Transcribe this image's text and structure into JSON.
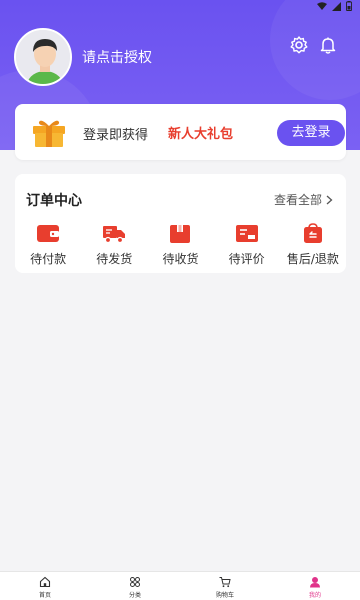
{
  "header": {
    "auth_prompt": "请点击授权"
  },
  "promo": {
    "text": "登录即获得",
    "highlight": "新人大礼包",
    "button_label": "去登录",
    "highlight_color": "#e83e2e"
  },
  "orders": {
    "title": "订单中心",
    "view_all": "查看全部",
    "items": [
      {
        "label": "待付款",
        "icon": "wallet-icon"
      },
      {
        "label": "待发货",
        "icon": "truck-icon"
      },
      {
        "label": "待收货",
        "icon": "box-icon"
      },
      {
        "label": "待评价",
        "icon": "review-card-icon"
      },
      {
        "label": "售后/退款",
        "icon": "refund-bag-icon"
      }
    ],
    "icon_color": "#e83e2e"
  },
  "tabbar": {
    "items": [
      {
        "label": "首页",
        "icon": "home-icon"
      },
      {
        "label": "分类",
        "icon": "grid-icon"
      },
      {
        "label": "购物车",
        "icon": "cart-icon"
      },
      {
        "label": "我的",
        "icon": "user-icon"
      }
    ],
    "active_color": "#e0338a"
  },
  "theme": {
    "brand_color": "#6a52f0"
  }
}
